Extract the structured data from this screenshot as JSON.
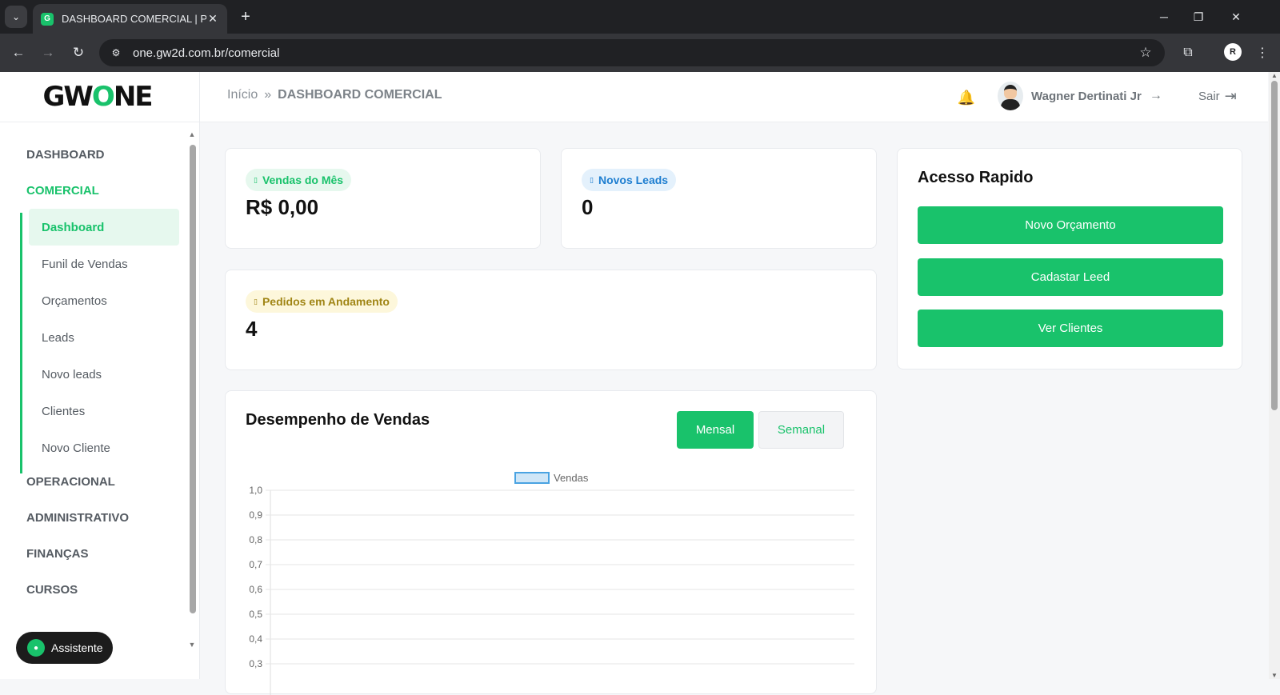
{
  "browser": {
    "tab_title": "DASHBOARD COMERCIAL | Port",
    "url": "one.gw2d.com.br/comercial",
    "profile_initials": "R"
  },
  "sidebar": {
    "logo": {
      "g": "GW",
      "o": "O",
      "ne": "NE"
    },
    "sections": [
      {
        "label": "DASHBOARD"
      },
      {
        "label": "COMERCIAL"
      },
      {
        "label": "OPERACIONAL"
      },
      {
        "label": "ADMINISTRATIVO"
      },
      {
        "label": "FINANÇAS"
      },
      {
        "label": "CURSOS"
      }
    ],
    "submenu": [
      {
        "label": "Dashboard"
      },
      {
        "label": "Funil de Vendas"
      },
      {
        "label": "Orçamentos"
      },
      {
        "label": "Leads"
      },
      {
        "label": "Novo leads"
      },
      {
        "label": "Clientes"
      },
      {
        "label": "Novo Cliente"
      }
    ],
    "assistant_label": "Assistente"
  },
  "header": {
    "breadcrumb_home": "Início",
    "breadcrumb_sep": "»",
    "breadcrumb_current": "DASHBOARD COMERCIAL",
    "user_name": "Wagner Dertinati Jr",
    "logout_label": "Sair"
  },
  "stats": {
    "sales": {
      "label": "Vendas do Mês",
      "value": "R$ 0,00"
    },
    "leads": {
      "label": "Novos Leads",
      "value": "0"
    },
    "orders": {
      "label": "Pedidos em Andamento",
      "value": "4"
    }
  },
  "quick_access": {
    "title": "Acesso Rapido",
    "buttons": [
      "Novo Orçamento",
      "Cadastar Leed",
      "Ver Clientes"
    ]
  },
  "performance": {
    "title": "Desempenho de Vendas",
    "toggle_monthly": "Mensal",
    "toggle_weekly": "Semanal"
  },
  "chart_data": {
    "type": "bar",
    "legend": [
      "Vendas"
    ],
    "series": [
      {
        "name": "Vendas",
        "values": []
      }
    ],
    "ylim": [
      0,
      1
    ],
    "yticks": [
      "1,0",
      "0,9",
      "0,8",
      "0,7",
      "0,6",
      "0,5",
      "0,4",
      "0,3"
    ],
    "grid": true,
    "legend_position": "top-center",
    "colors": {
      "fill": "#cfe6f7",
      "stroke": "#4aa3e2"
    }
  },
  "colors": {
    "accent": "#19c26b"
  }
}
